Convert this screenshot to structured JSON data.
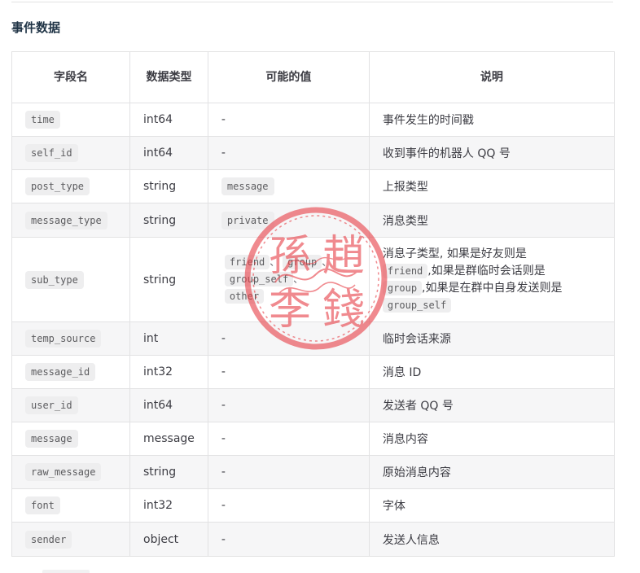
{
  "section": {
    "title": "事件数据"
  },
  "table": {
    "headers": {
      "field": "字段名",
      "type": "数据类型",
      "values": "可能的值",
      "desc": "说明"
    },
    "rows": [
      {
        "field": "time",
        "type": "int64",
        "value": "-",
        "desc": "事件发生的时间戳"
      },
      {
        "field": "self_id",
        "type": "int64",
        "value": "-",
        "desc": "收到事件的机器人 QQ 号"
      },
      {
        "field": "post_type",
        "type": "string",
        "value": "message",
        "desc": "上报类型"
      },
      {
        "field": "message_type",
        "type": "string",
        "value": "private",
        "desc": "消息类型"
      },
      {
        "field": "sub_type",
        "type": "string",
        "values": [
          "friend",
          "group",
          "group_self",
          "other"
        ],
        "separator": "、",
        "desc_parts": {
          "p1": "消息子类型, 如果是好友则是",
          "c1": "friend",
          "p2": ",如果是群临时会话则是",
          "c2": "group",
          "p3": ",如果是在群中自身发送则是",
          "c3": "group_self"
        }
      },
      {
        "field": "temp_source",
        "type": "int",
        "value": "-",
        "desc": "临时会话来源"
      },
      {
        "field": "message_id",
        "type": "int32",
        "value": "-",
        "desc": "消息 ID"
      },
      {
        "field": "user_id",
        "type": "int64",
        "value": "-",
        "desc": "发送者 QQ 号"
      },
      {
        "field": "message",
        "type": "message",
        "value": "-",
        "desc": "消息内容"
      },
      {
        "field": "raw_message",
        "type": "string",
        "value": "-",
        "desc": "原始消息内容"
      },
      {
        "field": "font",
        "type": "int32",
        "value": "-",
        "desc": "字体"
      },
      {
        "field": "sender",
        "type": "object",
        "value": "-",
        "desc": "发送人信息"
      }
    ]
  },
  "seal": {
    "color": "#e8444b",
    "chars": [
      "趙",
      "錢",
      "孫",
      "李"
    ]
  },
  "colors": {
    "border": "#e2e2e3",
    "stripe": "#f6f6f7",
    "code_bg": "#eeeeef",
    "text": "#3c3c43"
  }
}
